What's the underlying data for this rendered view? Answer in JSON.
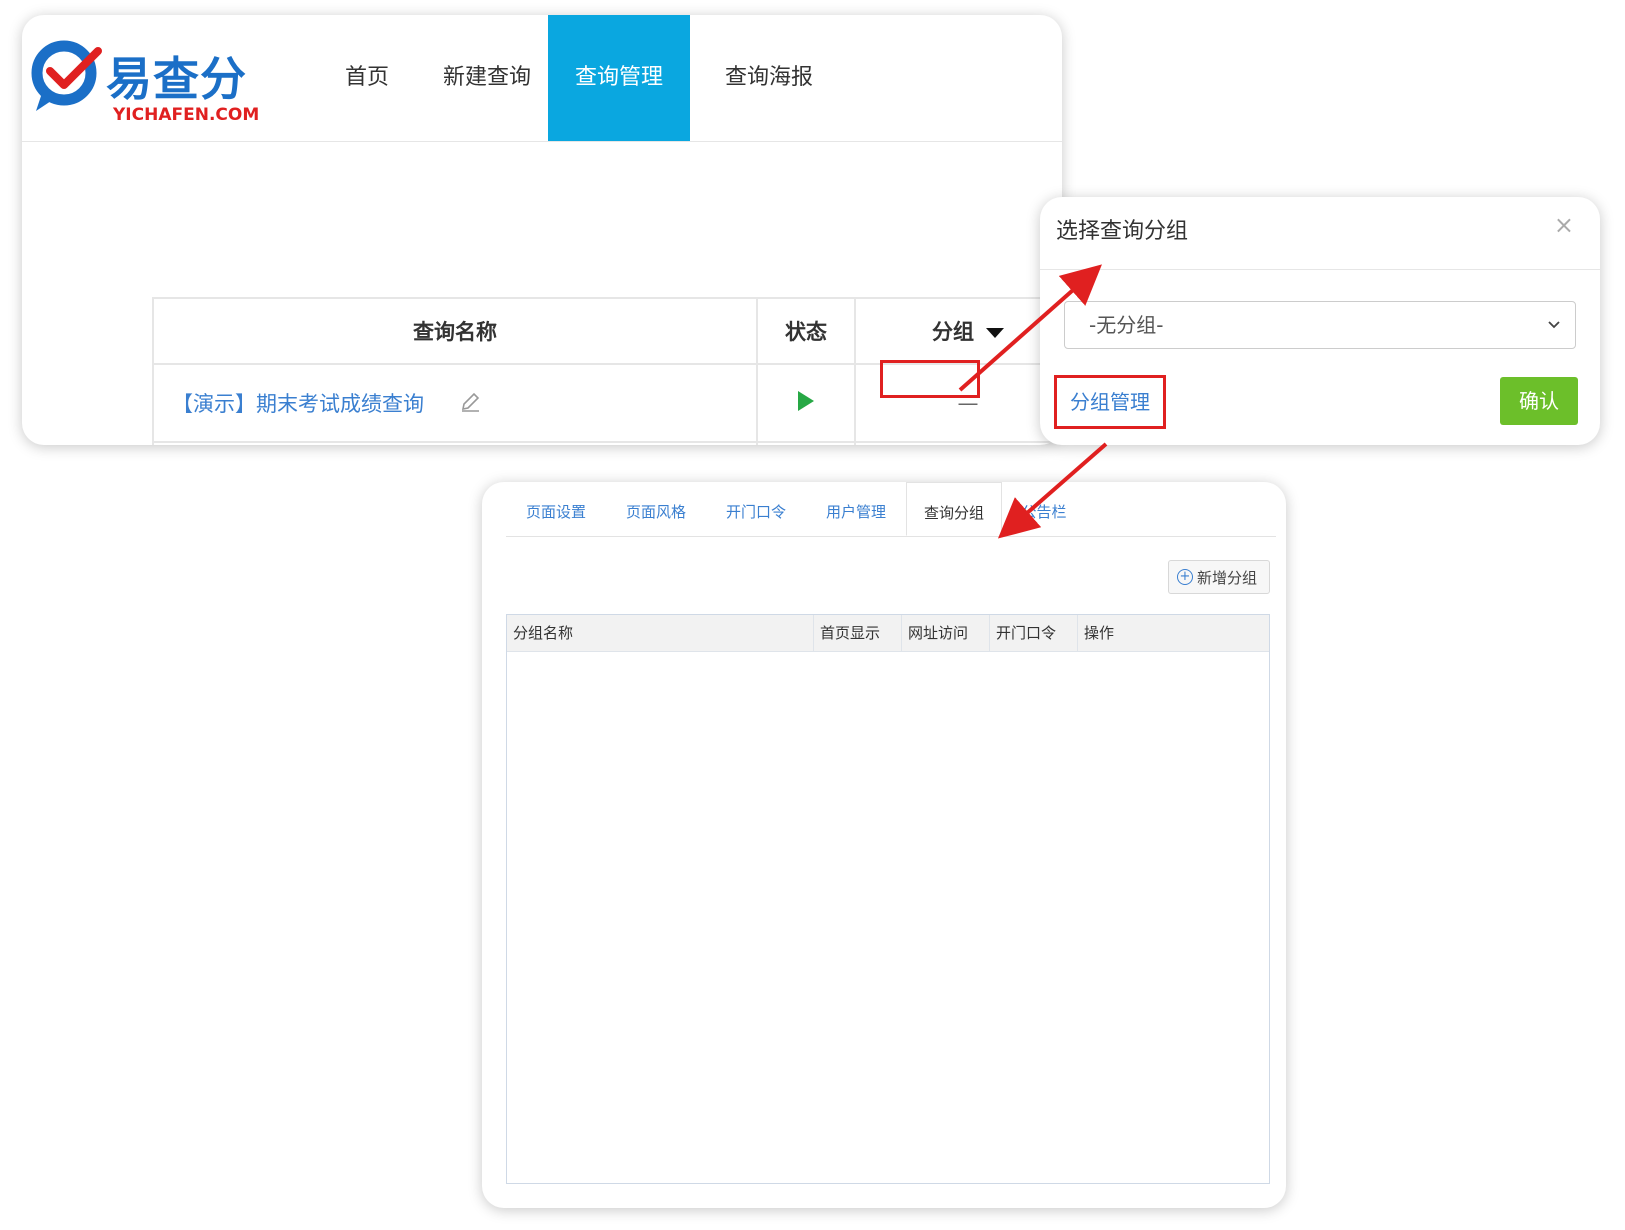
{
  "logo": {
    "brand": "易查分",
    "domain": "YICHAFEN.COM"
  },
  "nav": {
    "home": "首页",
    "new_query": "新建查询",
    "manage": "查询管理",
    "poster": "查询海报"
  },
  "query_table": {
    "headers": {
      "name": "查询名称",
      "status": "状态",
      "group": "分组"
    },
    "row": {
      "name": "【演示】期末考试成绩查询",
      "group": "—"
    }
  },
  "dialog": {
    "title": "选择查询分组",
    "close": "×",
    "select_value": "-无分组-",
    "manage_link": "分组管理",
    "confirm": "确认"
  },
  "group_panel": {
    "tabs": [
      "页面设置",
      "页面风格",
      "开门口令",
      "用户管理",
      "查询分组",
      "公告栏"
    ],
    "active_tab": "查询分组",
    "add_button": "新增分组",
    "columns": [
      "分组名称",
      "首页显示",
      "网址访问",
      "开门口令",
      "操作"
    ]
  },
  "colors": {
    "accent": "#0aa7e0",
    "link": "#3a7fd0",
    "highlight": "#e02020",
    "confirm": "#6cbf2a",
    "play": "#27a845"
  }
}
